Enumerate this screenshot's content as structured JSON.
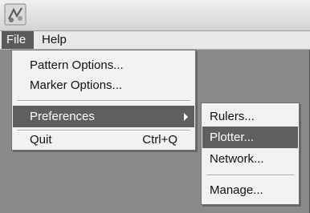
{
  "menubar": {
    "items": [
      {
        "label": "File"
      },
      {
        "label": "Help"
      }
    ]
  },
  "file_menu": {
    "pattern_options": "Pattern Options...",
    "marker_options": "Marker Options...",
    "preferences": "Preferences",
    "quit": "Quit",
    "quit_shortcut": "Ctrl+Q"
  },
  "preferences_menu": {
    "rulers": "Rulers...",
    "plotter": "Plotter...",
    "network": "Network...",
    "manage": "Manage..."
  },
  "icons": {
    "app": "app-logo-icon",
    "submenu": "submenu-arrow-icon"
  },
  "colors": {
    "highlight": "#5f5f5f",
    "menu_background": "#f2f2f2",
    "window_background": "#8a8a8a"
  }
}
